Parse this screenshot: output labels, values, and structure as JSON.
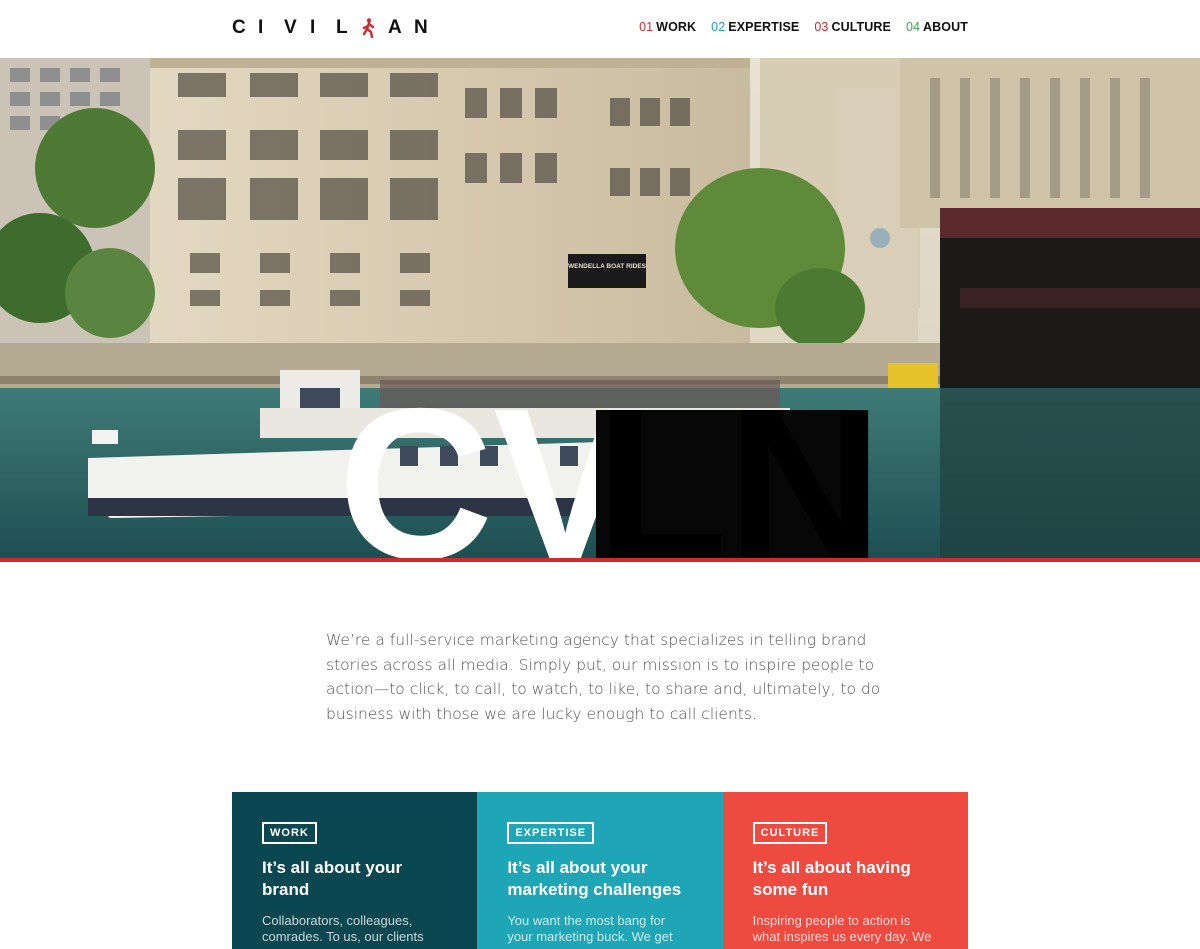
{
  "header": {
    "logo_letters": [
      "C",
      "I",
      "V",
      "I",
      "L",
      "A",
      "N"
    ],
    "nav": [
      {
        "num": "01",
        "label": "WORK",
        "color": "#d02a2f"
      },
      {
        "num": "02",
        "label": "EXPERTISE",
        "color": "#1ea5b6"
      },
      {
        "num": "03",
        "label": "CULTURE",
        "color": "#d02a2f"
      },
      {
        "num": "04",
        "label": "ABOUT",
        "color": "#3aa84a"
      }
    ]
  },
  "hero": {
    "overlay_text": "CVLN",
    "sign_text": "WENDELLA BOAT RIDES",
    "accent_line_color": "#d02a2f"
  },
  "intro": {
    "text": "We’re a full-service marketing agency that specializes in telling brand stories across all media. Simply put, our mission is to inspire people to action—to click, to call, to watch, to like, to share and, ultimately, to do business with those we are lucky enough to call clients."
  },
  "cards": [
    {
      "tag": "WORK",
      "title": "It’s all about your brand",
      "body": "Collaborators, colleagues, comrades. To us, our clients",
      "color": "#0b4751"
    },
    {
      "tag": "EXPERTISE",
      "title": "It’s all about your marketing challenges",
      "body": "You want the most bang for your marketing buck. We get",
      "color": "#1ea5b6"
    },
    {
      "tag": "CULTURE",
      "title": "It’s all about having some fun",
      "body": "Inspiring people to action is what inspires us every day. We",
      "color": "#ee4a3f"
    }
  ]
}
